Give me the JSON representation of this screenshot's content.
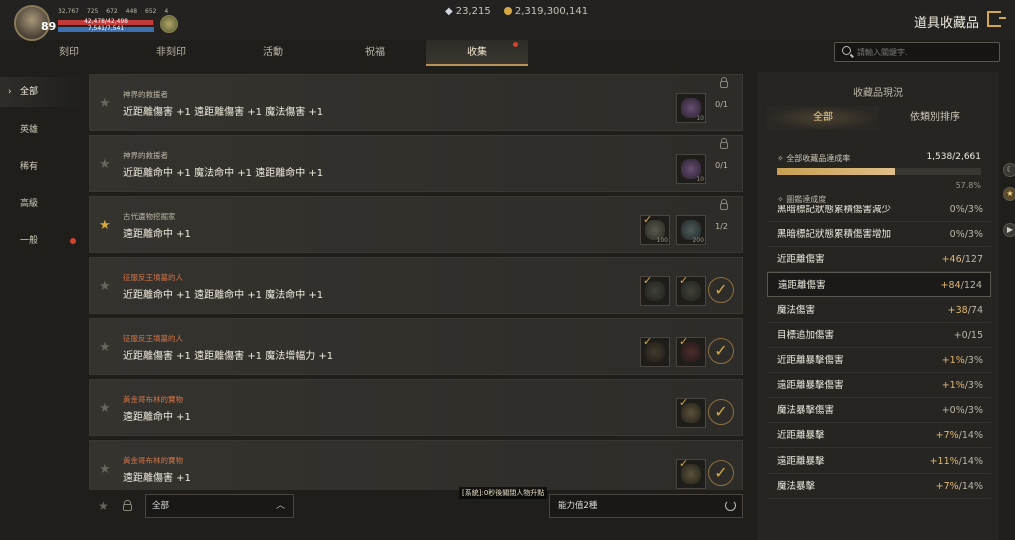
{
  "player": {
    "level": "89",
    "stats": [
      "32,767",
      "725",
      "672",
      "448",
      "652",
      "4"
    ],
    "hp": "42,478/42,498",
    "mp": "7,541/7,541",
    "hp_fraction": 0.99,
    "mp_fraction": 1.0
  },
  "currency": {
    "gems": "23,215",
    "gold": "2,319,300,141"
  },
  "page_title": "道具收藏品",
  "tabs": [
    "刻印",
    "非刻印",
    "活動",
    "祝福",
    "收集"
  ],
  "search": {
    "placeholder": "請輸入關鍵字."
  },
  "sidebar": [
    "全部",
    "英雄",
    "稀有",
    "高級",
    "一般"
  ],
  "cards": [
    {
      "category": "神界的救援者",
      "effect": "近距離傷害 +1 遠距離傷害 +1 魔法傷害 +1",
      "progress": "0/1",
      "slots": [
        {
          "count": "10"
        }
      ]
    },
    {
      "category": "神界的救援者",
      "effect": "近距離命中 +1 魔法命中 +1 遠距離命中 +1",
      "progress": "0/1",
      "slots": [
        {
          "count": "10"
        }
      ]
    },
    {
      "category": "古代遺物挖掘家",
      "effect": "遠距離命中 +1",
      "progress": "1/2",
      "slots": [
        {
          "count": "100"
        },
        {
          "count": "200"
        }
      ]
    },
    {
      "category": "征服反王墳墓的人",
      "effect": "近距離命中 +1 遠距離命中 +1 魔法命中 +1"
    },
    {
      "category": "征服反王墳墓的人",
      "effect": "近距離傷害 +1 遠距離傷害 +1 魔法增幅力 +1"
    },
    {
      "category": "黃金哥布林的寶物",
      "effect": "遠距離命中 +1"
    },
    {
      "category": "黃金哥布林的寶物",
      "effect": "遠距離傷害 +1"
    }
  ],
  "bottom": {
    "filter": "全部",
    "ability": "能力值2種",
    "system_msg": "[系統]:0秒後關閉人物升點"
  },
  "panel": {
    "title": "收藏品現況",
    "tabs": [
      "全部",
      "依類別排序"
    ],
    "rate_label": "全部收藏品達成率",
    "rate_value": "1,538/2,661",
    "rate_fraction": 0.578,
    "rate_pct": "57.8%",
    "dex_label": "圖鑑達成度",
    "stats": [
      {
        "name": "黑暗標記狀態累積傷害減少",
        "value": "0%/3%"
      },
      {
        "name": "黑暗標記狀態累積傷害增加",
        "value": "0%/3%"
      },
      {
        "name": "近距離傷害",
        "gain": "+46",
        "max": "/127"
      },
      {
        "name": "遠距離傷害",
        "gain": "+84",
        "max": "/124"
      },
      {
        "name": "魔法傷害",
        "gain": "+38",
        "max": "/74"
      },
      {
        "name": "目標追加傷害",
        "value": "+0/15"
      },
      {
        "name": "近距離暴擊傷害",
        "gain": "+1%",
        "max": "/3%"
      },
      {
        "name": "遠距離暴擊傷害",
        "gain": "+1%",
        "max": "/3%"
      },
      {
        "name": "魔法暴擊傷害",
        "value": "+0%/3%"
      },
      {
        "name": "近距離暴擊",
        "gain": "+7%",
        "max": "/14%"
      },
      {
        "name": "遠距離暴擊",
        "gain": "+11%",
        "max": "/14%"
      },
      {
        "name": "魔法暴擊",
        "gain": "+7%",
        "max": "/14%"
      }
    ]
  }
}
